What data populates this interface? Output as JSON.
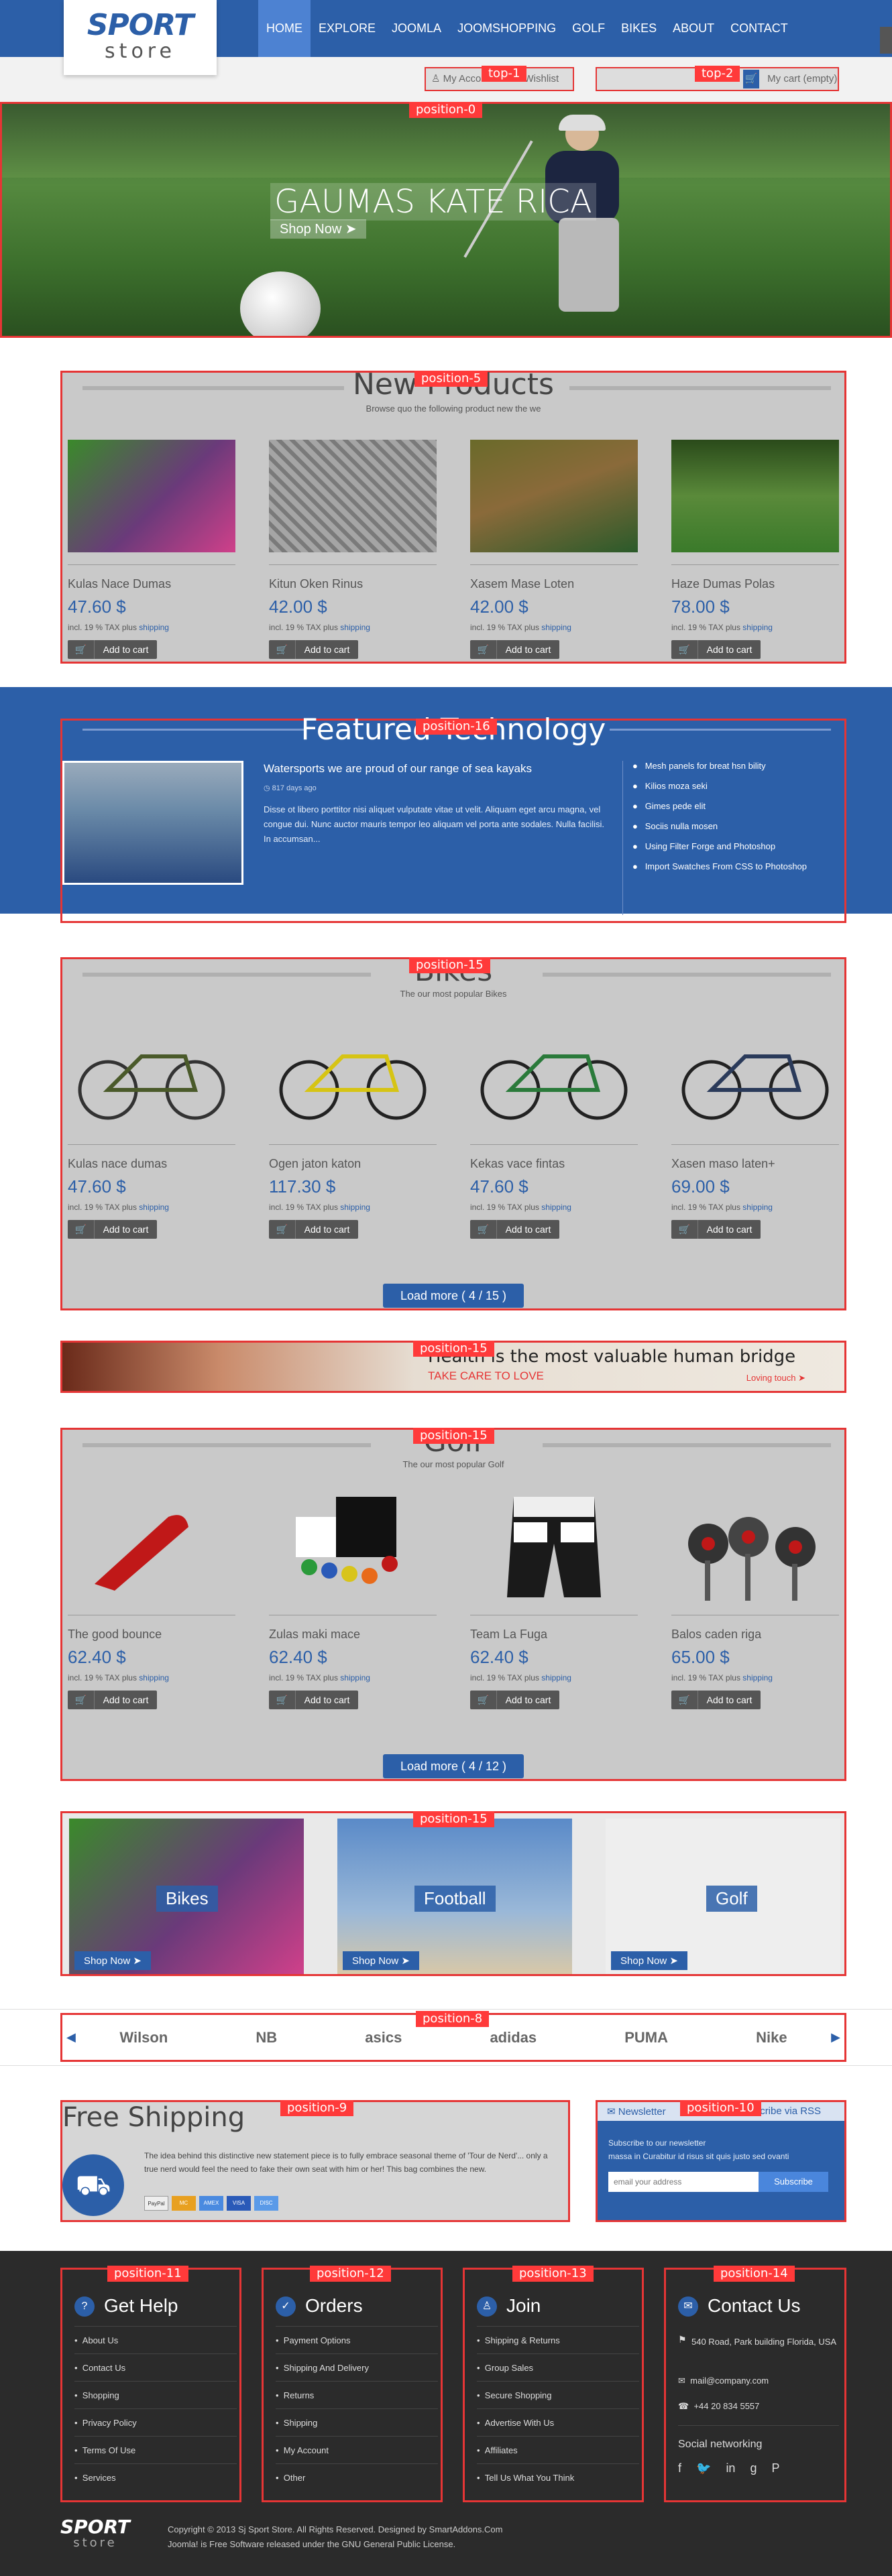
{
  "logo": {
    "line1": "SPORT",
    "line2": "store"
  },
  "nav": [
    "HOME",
    "EXPLORE",
    "JOOMLA",
    "JOOMSHOPPING",
    "GOLF",
    "BIKES",
    "ABOUT",
    "CONTACT"
  ],
  "topbar": {
    "account": "My Acco",
    "wishlist": "Wishlist",
    "cart": "My cart (empty)",
    "tag1": "top-1",
    "tag2": "top-2"
  },
  "banner": {
    "tag": "position-0",
    "title": "GAUMAS KATE RICA",
    "shop_now": "Shop Now"
  },
  "new_products": {
    "tag": "position-5",
    "title": "New Products",
    "subtitle": "Browse quo the following product new the we",
    "items": [
      {
        "name": "Kulas Nace Dumas",
        "price": "47.60 $"
      },
      {
        "name": "Kitun Oken Rinus",
        "price": "42.00 $"
      },
      {
        "name": "Xasem Mase Loten",
        "price": "42.00 $"
      },
      {
        "name": "Haze Dumas Polas",
        "price": "78.00 $"
      }
    ]
  },
  "common": {
    "tax": "incl. 19 % TAX plus",
    "shipping": "shipping",
    "add_to_cart": "Add to cart"
  },
  "featured": {
    "tag": "position-16",
    "title": "Featured Technology",
    "article_title": "Watersports we are proud of our range of sea kayaks",
    "date": "817 days ago",
    "body": "Disse ot libero porttitor nisi aliquet vulputate vitae ut velit. Aliquam eget arcu magna, vel congue dui. Nunc auctor mauris tempor leo aliquam vel porta ante sodales. Nulla facilisi. In accumsan...",
    "list": [
      "Mesh panels for breat hsn bility",
      "Kilios moza seki",
      "Gimes pede elit",
      "Sociis nulla mosen",
      "Using Filter Forge and Photoshop",
      "Import Swatches From CSS to Photoshop"
    ]
  },
  "bikes": {
    "tag": "position-15",
    "title": "Bikes",
    "subtitle": "The our most popular Bikes",
    "items": [
      {
        "name": "Kulas nace dumas",
        "price": "47.60 $"
      },
      {
        "name": "Ogen jaton katon",
        "price": "117.30 $"
      },
      {
        "name": "Kekas vace fintas",
        "price": "47.60 $"
      },
      {
        "name": "Xasen maso laten+",
        "price": "69.00 $"
      }
    ],
    "load_more": "Load more ( 4 / 15 )"
  },
  "health": {
    "tag": "position-15",
    "title": "Health is the most valuable human bridge",
    "sub": "TAKE CARE TO LOVE",
    "link": "Loving touch"
  },
  "golf": {
    "tag": "position-15",
    "title": "Golf",
    "subtitle": "The our most popular Golf",
    "items": [
      {
        "name": "The good bounce",
        "price": "62.40 $"
      },
      {
        "name": "Zulas maki mace",
        "price": "62.40 $"
      },
      {
        "name": "Team La Fuga",
        "price": "62.40 $"
      },
      {
        "name": "Balos caden riga",
        "price": "65.00 $"
      }
    ],
    "load_more": "Load more ( 4 / 12 )"
  },
  "categories": {
    "tag": "position-15",
    "items": [
      "Bikes",
      "Football",
      "Golf"
    ],
    "shop_now": "Shop Now"
  },
  "brands": {
    "tag": "position-8",
    "items": [
      "Wilson",
      "NB",
      "asics",
      "adidas",
      "PUMA",
      "Nike"
    ]
  },
  "shipping": {
    "tag": "position-9",
    "title": "Free Shipping",
    "body": "The idea behind this distinctive new statement piece is to fully embrace seasonal theme of 'Tour de Nerd'... only a true nerd would feel the need to fake their own seat with him or her! This bag combines the new.",
    "cards": [
      "PayPal",
      "MC",
      "AMEX",
      "VISA",
      "DISC"
    ]
  },
  "newsletter": {
    "tag": "position-10",
    "title": "Newsletter",
    "rss": "Subscribe via RSS",
    "text1": "Subscribe to our newsletter",
    "text2": "massa in Curabitur id risus sit quis justo sed ovanti",
    "placeholder": "email your address",
    "button": "Subscribe"
  },
  "footer": {
    "help": {
      "tag": "position-11",
      "title": "Get Help",
      "items": [
        "About Us",
        "Contact Us",
        "Shopping",
        "Privacy Policy",
        "Terms Of Use",
        "Services"
      ]
    },
    "orders": {
      "tag": "position-12",
      "title": "Orders",
      "items": [
        "Payment Options",
        "Shipping And Delivery",
        "Returns",
        "Shipping",
        "My Account",
        "Other"
      ]
    },
    "join": {
      "tag": "position-13",
      "title": "Join",
      "items": [
        "Shipping & Returns",
        "Group Sales",
        "Secure Shopping",
        "Advertise With Us",
        "Affiliates",
        "Tell Us What You Think"
      ]
    },
    "contact": {
      "tag": "position-14",
      "title": "Contact Us",
      "address": "540 Road, Park building Florida, USA",
      "email": "mail@company.com",
      "phone": "+44 20 834 5557",
      "social": "Social networking"
    },
    "copyright": "Copyright © 2013 Sj Sport Store. All Rights Reserved. Designed by SmartAddons.Com",
    "license": "Joomla! is Free Software released under the GNU General Public License."
  },
  "colors": {
    "primary": "#2c5fa8",
    "tag": "#ff3a3a",
    "footer": "#2b2b2b"
  }
}
